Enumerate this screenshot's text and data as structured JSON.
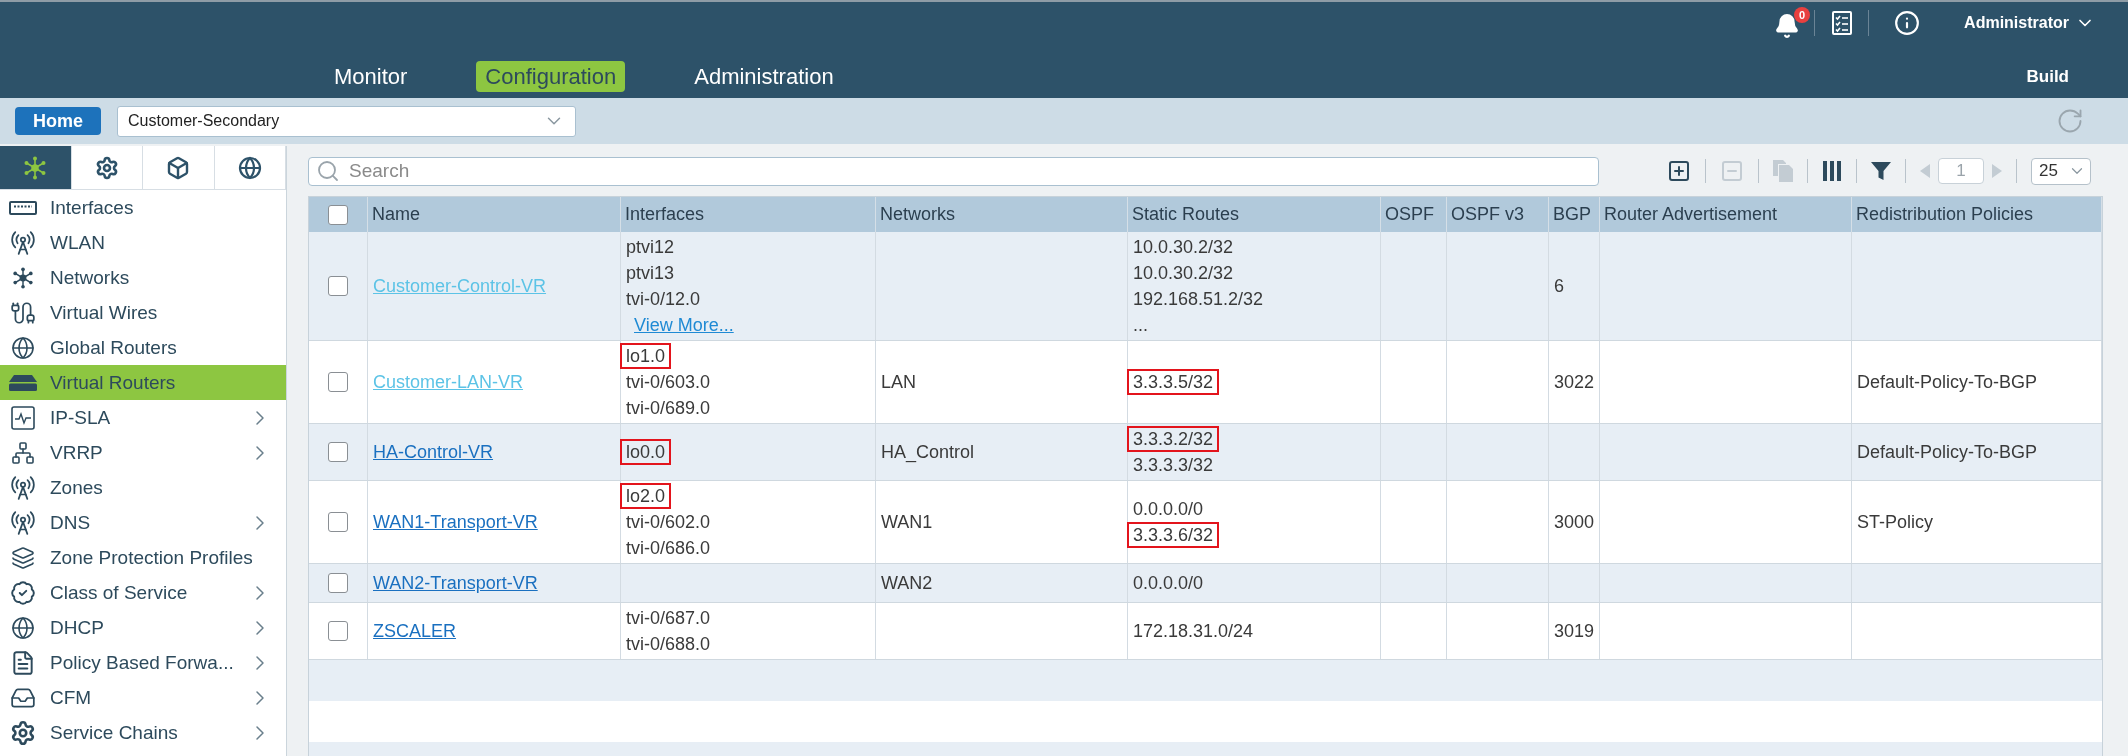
{
  "header": {
    "alerts_count": "0",
    "user": "Administrator",
    "build_link": "Build"
  },
  "nav": [
    {
      "label": "Monitor",
      "selected": false
    },
    {
      "label": "Configuration",
      "selected": true
    },
    {
      "label": "Administration",
      "selected": false
    }
  ],
  "context_bar": {
    "home": "Home",
    "organization": "Customer-Secondary"
  },
  "sidebar": {
    "tabs": [
      {
        "kind": "hub",
        "selected": true
      },
      {
        "kind": "gear",
        "selected": false
      },
      {
        "kind": "cube",
        "selected": false
      },
      {
        "kind": "globe",
        "selected": false
      }
    ],
    "items": [
      {
        "label": "Interfaces",
        "kind": "port",
        "selected": false,
        "expandable": false
      },
      {
        "label": "WLAN",
        "kind": "antenna",
        "selected": false,
        "expandable": false
      },
      {
        "label": "Networks",
        "kind": "hub",
        "selected": false,
        "expandable": false
      },
      {
        "label": "Virtual Wires",
        "kind": "cable",
        "selected": false,
        "expandable": false
      },
      {
        "label": "Global Routers",
        "kind": "globe",
        "selected": false,
        "expandable": false
      },
      {
        "label": "Virtual Routers",
        "kind": "router",
        "selected": true,
        "expandable": false
      },
      {
        "label": "IP-SLA",
        "kind": "pulse",
        "selected": false,
        "expandable": true
      },
      {
        "label": "VRRP",
        "kind": "hierarchy",
        "selected": false,
        "expandable": true
      },
      {
        "label": "Zones",
        "kind": "antenna",
        "selected": false,
        "expandable": false
      },
      {
        "label": "DNS",
        "kind": "antenna",
        "selected": false,
        "expandable": true
      },
      {
        "label": "Zone Protection Profiles",
        "kind": "layers",
        "selected": false,
        "expandable": false
      },
      {
        "label": "Class of Service",
        "kind": "badge",
        "selected": false,
        "expandable": true
      },
      {
        "label": "DHCP",
        "kind": "globe",
        "selected": false,
        "expandable": true
      },
      {
        "label": "Policy Based Forwa...",
        "kind": "document",
        "selected": false,
        "expandable": true
      },
      {
        "label": "CFM",
        "kind": "tray",
        "selected": false,
        "expandable": true
      },
      {
        "label": "Service Chains",
        "kind": "gear",
        "selected": false,
        "expandable": true
      }
    ]
  },
  "toolbar": {
    "search_placeholder": "Search",
    "actions": [
      {
        "kind": "add",
        "disabled": false
      },
      {
        "kind": "remove",
        "disabled": true
      },
      {
        "kind": "clone",
        "disabled": true
      },
      {
        "kind": "columns",
        "disabled": false
      },
      {
        "kind": "filter",
        "disabled": false
      }
    ],
    "pager": {
      "previous_disabled": true,
      "page": "1",
      "next_disabled": true,
      "page_size": "25"
    }
  },
  "table": {
    "all_checked": false,
    "columns": [
      "Name",
      "Interfaces",
      "Networks",
      "Static Routes",
      "OSPF",
      "OSPF v3",
      "BGP",
      "Router Advertisement",
      "Redistribution Policies"
    ],
    "rows": [
      {
        "checked": false,
        "name": "Customer-Control-VR",
        "visited": true,
        "interfaces": [
          {
            "text": "ptvi12",
            "highlighted": false
          },
          {
            "text": "ptvi13",
            "highlighted": false
          },
          {
            "text": "tvi-0/12.0",
            "highlighted": false
          }
        ],
        "interfaces_more": "View More...",
        "static_routes": [
          {
            "text": "10.0.30.2/32",
            "highlighted": false
          },
          {
            "text": "10.0.30.2/32",
            "highlighted": false
          },
          {
            "text": "192.168.51.2/32",
            "highlighted": false
          },
          {
            "text": "...",
            "highlighted": false
          }
        ],
        "bgp": "6"
      },
      {
        "checked": false,
        "name": "Customer-LAN-VR",
        "visited": true,
        "interfaces": [
          {
            "text": "lo1.0",
            "highlighted": true
          },
          {
            "text": "tvi-0/603.0",
            "highlighted": false
          },
          {
            "text": "tvi-0/689.0",
            "highlighted": false
          }
        ],
        "networks": "LAN",
        "static_routes": [
          {
            "text": "3.3.3.5/32",
            "highlighted": true
          }
        ],
        "bgp": "3022",
        "redistribution_policies": "Default-Policy-To-BGP"
      },
      {
        "checked": false,
        "name": "HA-Control-VR",
        "visited": false,
        "interfaces": [
          {
            "text": "lo0.0",
            "highlighted": true
          }
        ],
        "networks": "HA_Control",
        "static_routes": [
          {
            "text": "3.3.3.2/32",
            "highlighted": true
          },
          {
            "text": "3.3.3.3/32",
            "highlighted": false
          }
        ],
        "redistribution_policies": "Default-Policy-To-BGP"
      },
      {
        "checked": false,
        "name": "WAN1-Transport-VR",
        "visited": false,
        "interfaces": [
          {
            "text": "lo2.0",
            "highlighted": true
          },
          {
            "text": "tvi-0/602.0",
            "highlighted": false
          },
          {
            "text": "tvi-0/686.0",
            "highlighted": false
          }
        ],
        "networks": "WAN1",
        "static_routes": [
          {
            "text": "0.0.0.0/0",
            "highlighted": false
          },
          {
            "text": "3.3.3.6/32",
            "highlighted": true
          }
        ],
        "bgp": "3000",
        "redistribution_policies": "ST-Policy"
      },
      {
        "checked": false,
        "name": "WAN2-Transport-VR",
        "visited": false,
        "networks": "WAN2",
        "static_routes": [
          {
            "text": "0.0.0.0/0",
            "highlighted": false
          }
        ]
      },
      {
        "checked": false,
        "name": "ZSCALER",
        "visited": false,
        "interfaces": [
          {
            "text": "tvi-0/687.0",
            "highlighted": false
          },
          {
            "text": "tvi-0/688.0",
            "highlighted": false
          }
        ],
        "static_routes": [
          {
            "text": "172.18.31.0/24",
            "highlighted": false
          }
        ],
        "bgp": "3019"
      }
    ]
  }
}
